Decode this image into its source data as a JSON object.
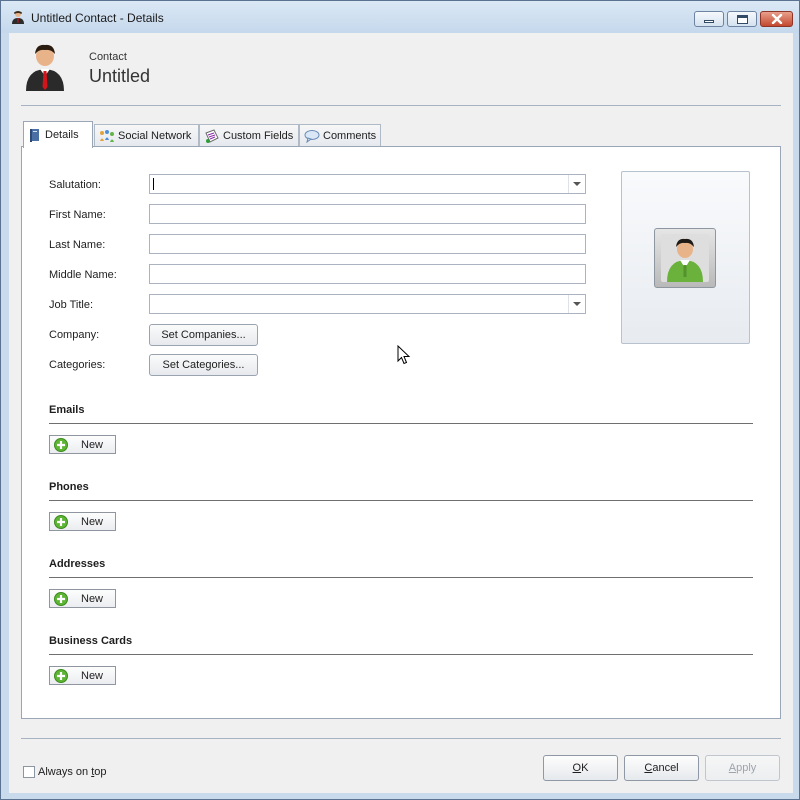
{
  "window": {
    "title": "Untitled Contact - Details"
  },
  "header": {
    "subtitle": "Contact",
    "name": "Untitled"
  },
  "tabs": [
    {
      "label": "Details",
      "icon": "book-icon",
      "active": true
    },
    {
      "label": "Social Network",
      "icon": "social-network-icon",
      "active": false
    },
    {
      "label": "Custom Fields",
      "icon": "custom-fields-icon",
      "active": false
    },
    {
      "label": "Comments",
      "icon": "speech-bubble-icon",
      "active": false
    }
  ],
  "form": {
    "salutation": {
      "label": "Salutation:",
      "value": ""
    },
    "first_name": {
      "label": "First Name:",
      "value": ""
    },
    "last_name": {
      "label": "Last Name:",
      "value": ""
    },
    "middle_name": {
      "label": "Middle Name:",
      "value": ""
    },
    "job_title": {
      "label": "Job Title:",
      "value": ""
    },
    "company": {
      "label": "Company:",
      "button": "Set Companies..."
    },
    "categories": {
      "label": "Categories:",
      "button": "Set Categories..."
    }
  },
  "sections": [
    {
      "title": "Emails",
      "new_label": "New"
    },
    {
      "title": "Phones",
      "new_label": "New"
    },
    {
      "title": "Addresses",
      "new_label": "New"
    },
    {
      "title": "Business Cards",
      "new_label": "New"
    }
  ],
  "footer": {
    "always_on_top": {
      "label_pre": "Always on ",
      "label_mnemonic": "t",
      "label_post": "op",
      "checked": false
    },
    "ok": {
      "mnemonic": "O",
      "rest": "K"
    },
    "cancel": {
      "mnemonic": "C",
      "rest": "ancel"
    },
    "apply": {
      "mnemonic": "A",
      "rest": "pply",
      "enabled": false
    }
  },
  "colors": {
    "accent_green": "#5db534",
    "panel_border": "#9aa6b6",
    "window_frame": "#c9daec"
  }
}
